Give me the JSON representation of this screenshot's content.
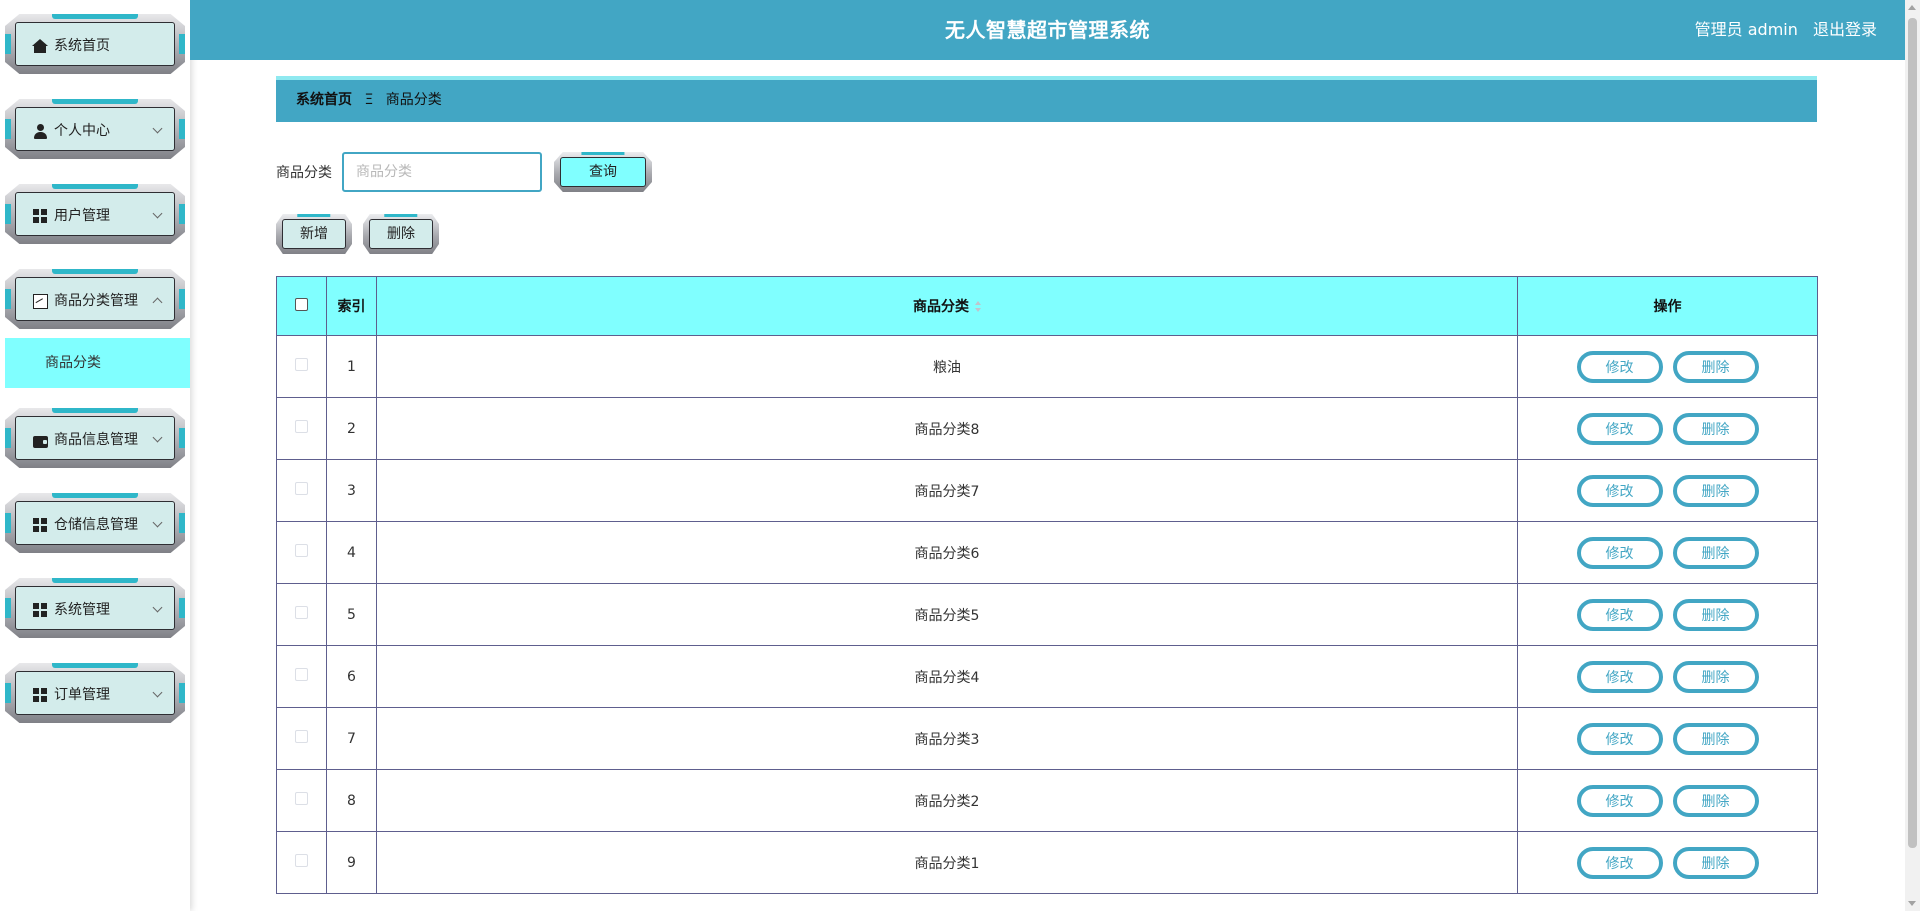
{
  "header": {
    "title": "无人智慧超市管理系统",
    "role": "管理员 admin",
    "logout": "退出登录"
  },
  "sidebar": {
    "items": [
      {
        "label": "系统首页",
        "icon": "home-icon",
        "expandable": false
      },
      {
        "label": "个人中心",
        "icon": "user-icon",
        "expandable": true
      },
      {
        "label": "用户管理",
        "icon": "grid-icon",
        "expandable": true
      },
      {
        "label": "商品分类管理",
        "icon": "chart-icon",
        "expandable": true,
        "expanded": true
      },
      {
        "label": "商品信息管理",
        "icon": "wallet-icon",
        "expandable": true
      },
      {
        "label": "仓储信息管理",
        "icon": "grid-icon",
        "expandable": true
      },
      {
        "label": "系统管理",
        "icon": "grid-icon",
        "expandable": true
      },
      {
        "label": "订单管理",
        "icon": "grid-icon",
        "expandable": true
      }
    ],
    "submenu": {
      "label": "商品分类"
    }
  },
  "breadcrumb": {
    "home": "系统首页",
    "separator": "Ξ",
    "current": "商品分类"
  },
  "search": {
    "label": "商品分类",
    "value": "",
    "placeholder": "商品分类",
    "button": "查询"
  },
  "actions": {
    "add": "新增",
    "delete": "删除"
  },
  "table": {
    "headers": {
      "index": "索引",
      "category": "商品分类",
      "operation": "操作"
    },
    "edit_label": "修改",
    "delete_label": "删除",
    "rows": [
      {
        "index": "1",
        "category": "粮油"
      },
      {
        "index": "2",
        "category": "商品分类8"
      },
      {
        "index": "3",
        "category": "商品分类7"
      },
      {
        "index": "4",
        "category": "商品分类6"
      },
      {
        "index": "5",
        "category": "商品分类5"
      },
      {
        "index": "6",
        "category": "商品分类4"
      },
      {
        "index": "7",
        "category": "商品分类3"
      },
      {
        "index": "8",
        "category": "商品分类2"
      },
      {
        "index": "9",
        "category": "商品分类1"
      }
    ]
  },
  "colors": {
    "primary": "#42a6c4",
    "highlight": "#80ffff",
    "panel": "#d3eceb"
  }
}
